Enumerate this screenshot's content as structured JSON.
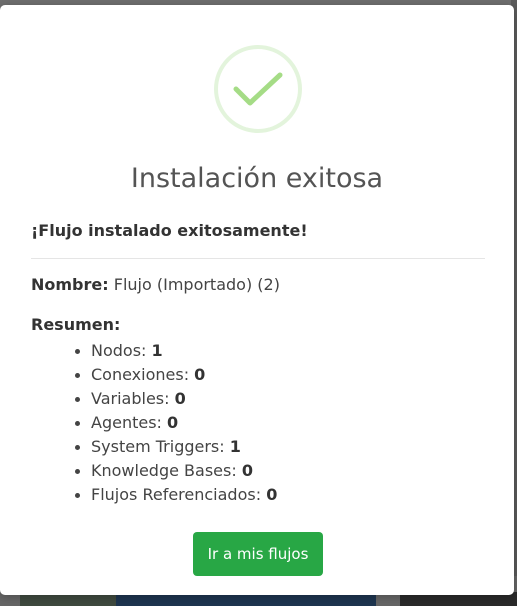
{
  "modal": {
    "title": "Instalación exitosa",
    "subtitle": "¡Flujo instalado exitosamente!",
    "name_label": "Nombre:",
    "name_value": "Flujo (Importado) (2)",
    "summary_label": "Resumen:",
    "summary_items": [
      {
        "label": "Nodos: ",
        "value": "1"
      },
      {
        "label": "Conexiones: ",
        "value": "0"
      },
      {
        "label": "Variables: ",
        "value": "0"
      },
      {
        "label": "Agentes: ",
        "value": "0"
      },
      {
        "label": "System Triggers: ",
        "value": "1"
      },
      {
        "label": "Knowledge Bases: ",
        "value": "0"
      },
      {
        "label": "Flujos Referenciados: ",
        "value": "0"
      }
    ],
    "button_label": "Ir a mis flujos",
    "icon": "check-icon"
  },
  "colors": {
    "success": "#28a745",
    "check": "#a5dc86",
    "check_ring": "#e3f4dc"
  }
}
